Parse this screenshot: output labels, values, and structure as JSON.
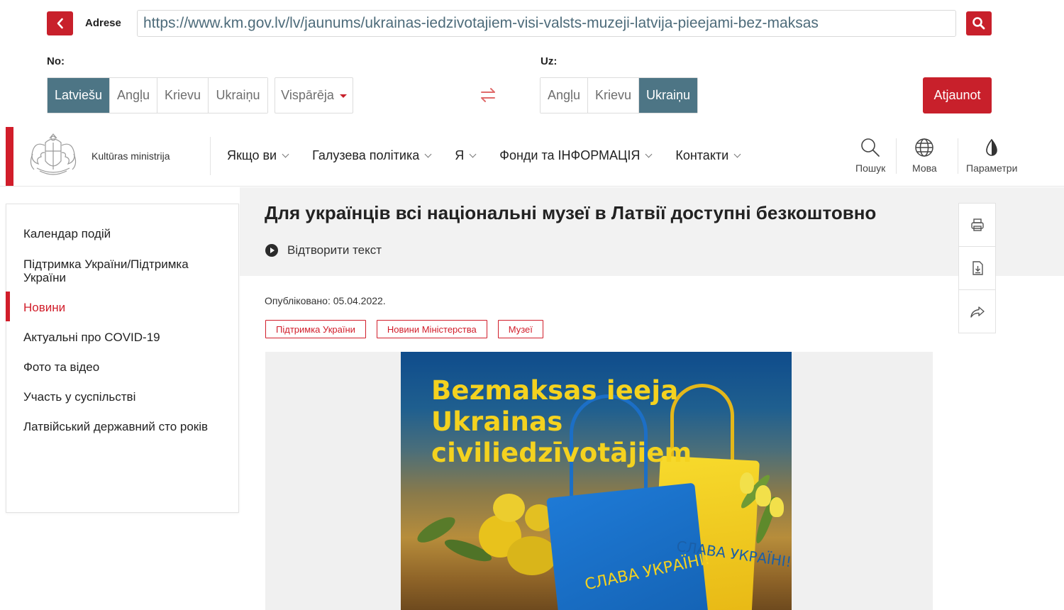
{
  "translator": {
    "address_label": "Adrese",
    "url": "https://www.km.gov.lv/lv/jaunums/ukrainas-iedzivotajiem-visi-valsts-muzeji-latvija-pieejami-bez-maksas",
    "from_label": "No:",
    "to_label": "Uz:",
    "from_languages": [
      "Latviešu",
      "Angļu",
      "Krievu",
      "Ukraiņu"
    ],
    "from_selected": "Latviešu",
    "domain_select": "Vispārēja",
    "to_languages": [
      "Angļu",
      "Krievu",
      "Ukraiņu"
    ],
    "to_selected": "Ukraiņu",
    "refresh_label": "Atjaunot",
    "accent_color": "#c8202b",
    "active_color": "#4d7585"
  },
  "site": {
    "org_name": "Kultūras ministrija",
    "nav": [
      "Якщо ви",
      "Галузева політика",
      "Я",
      "Фонди та ІНФОРМАЦІЯ",
      "Контакти"
    ],
    "tools": {
      "search": "Пошук",
      "language": "Мова",
      "settings": "Параметри"
    }
  },
  "sidebar": {
    "items": [
      {
        "label": "Календар подій"
      },
      {
        "label": "Підтримка України/Підтримка України"
      },
      {
        "label": "Новини",
        "active": true
      },
      {
        "label": "Актуальні про COVID-19"
      },
      {
        "label": "Фото та відео"
      },
      {
        "label": "Участь у суспільстві"
      },
      {
        "label": "Латвійський державний сто років"
      }
    ]
  },
  "article": {
    "title": "Для українців всі національні музеї в Латвії доступні безкоштовно",
    "play_label": "Відтворити текст",
    "published": "Опубліковано: 05.04.2022.",
    "tags": [
      "Підтримка України",
      "Новини Міністерства",
      "Музеї"
    ],
    "poster": {
      "lines": [
        "Bezmaksas ieeja",
        "Ukrainas",
        "civiliedzīvotājiem"
      ],
      "slava_blue_bag": "СЛАВА УКРАЇНІ!",
      "slava_yellow_bag": "СЛАВА УКРАЇНІ!"
    }
  }
}
